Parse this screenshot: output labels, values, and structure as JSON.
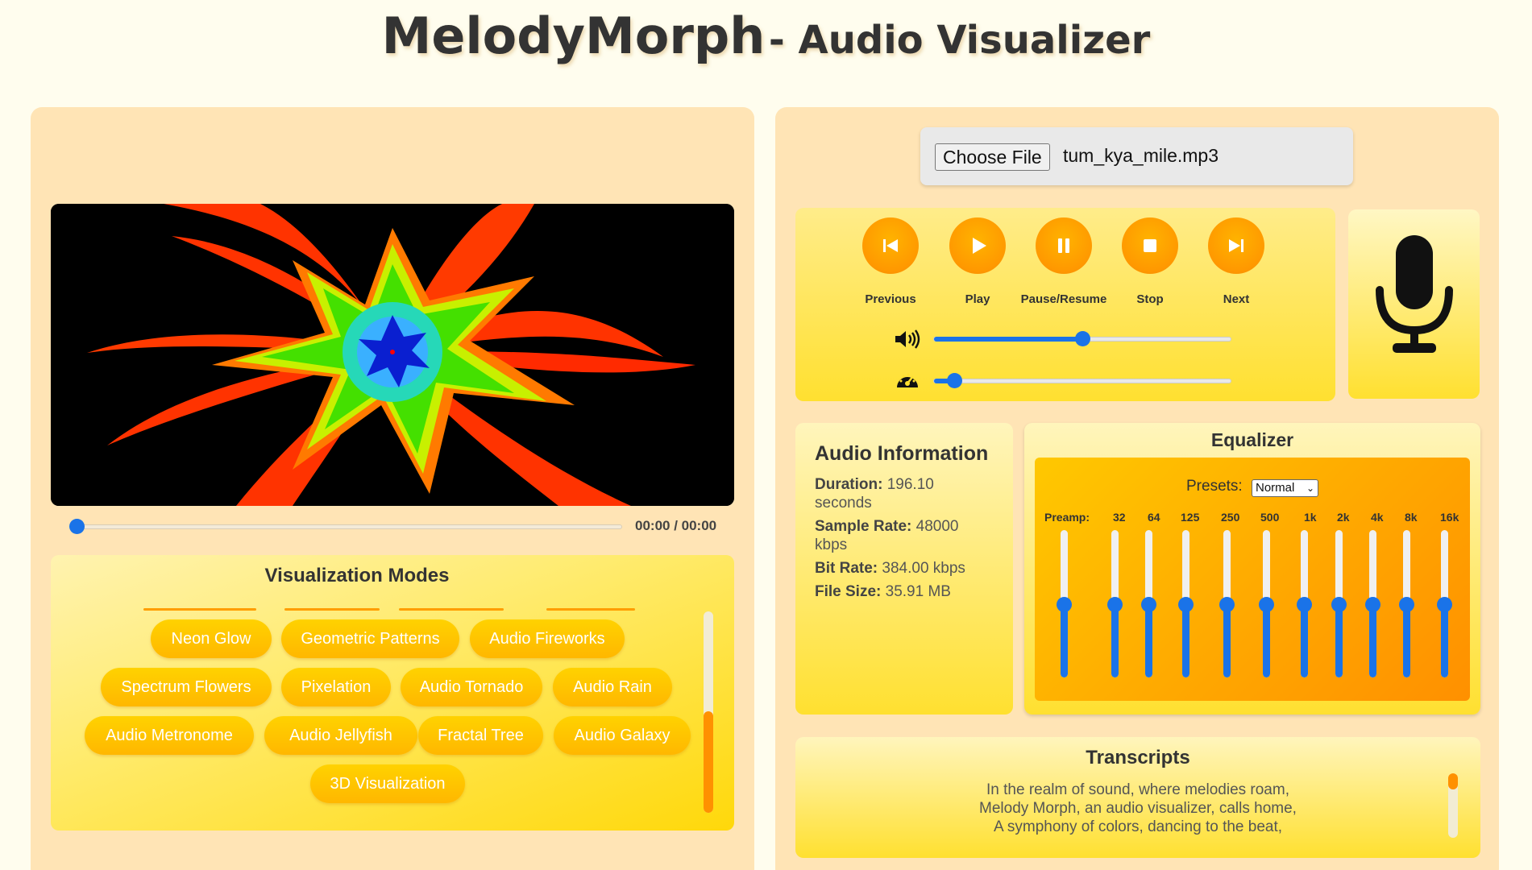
{
  "header": {
    "brand": "MelodyMorph",
    "subtitle": "- Audio Visualizer"
  },
  "player": {
    "time": "00:00 / 00:00",
    "progress": 0,
    "file_button": "Choose File",
    "file_name": "tum_kya_mile.mp3",
    "controls": [
      {
        "label": "Previous",
        "icon": "previous-icon"
      },
      {
        "label": "Play",
        "icon": "play-icon"
      },
      {
        "label": "Pause/Resume",
        "icon": "pause-icon"
      },
      {
        "label": "Stop",
        "icon": "stop-icon"
      },
      {
        "label": "Next",
        "icon": "next-icon"
      }
    ],
    "volume": 0.5,
    "speed": 0.07,
    "mic_icon": "microphone-icon"
  },
  "modes": {
    "title": "Visualization Modes",
    "items": [
      "Neon Glow",
      "Geometric Patterns",
      "Audio Fireworks",
      "Spectrum Flowers",
      "Pixelation",
      "Audio Tornado",
      "Audio Rain",
      "Audio Metronome",
      "Audio Jellyfish",
      "Fractal Tree",
      "Audio Galaxy",
      "3D Visualization"
    ]
  },
  "info": {
    "title": "Audio Information",
    "rows": [
      {
        "label": "Duration:",
        "value": "196.10 seconds"
      },
      {
        "label": "Sample Rate:",
        "value": "48000 kbps"
      },
      {
        "label": "Bit Rate:",
        "value": "384.00 kbps"
      },
      {
        "label": "File Size:",
        "value": "35.91 MB"
      }
    ]
  },
  "equalizer": {
    "title": "Equalizer",
    "presets_label": "Presets:",
    "preset_value": "Normal",
    "bands": [
      "Preamp:",
      "32",
      "64",
      "125",
      "250",
      "500",
      "1k",
      "2k",
      "4k",
      "8k",
      "16k"
    ],
    "band_level": 0.5
  },
  "transcripts": {
    "title": "Transcripts",
    "lines": [
      "In the realm of sound, where melodies roam,",
      "Melody Morph, an audio visualizer, calls home,",
      "A symphony of colors, dancing to the beat,"
    ]
  },
  "colors": {
    "accent_blue": "#1a73e8",
    "orange": "#ff9800",
    "panel": "#ffe4b5",
    "page_bg": "#fffdee"
  }
}
